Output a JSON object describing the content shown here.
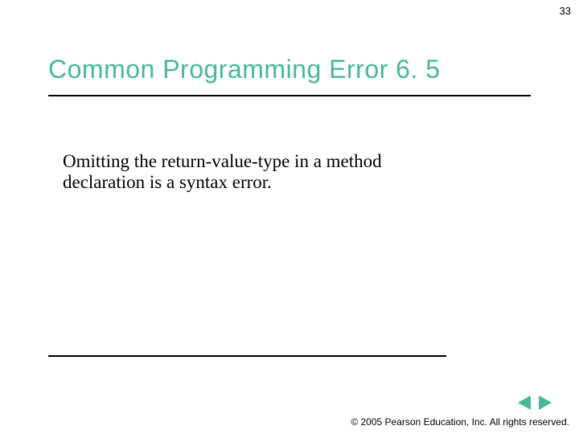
{
  "page_number": "33",
  "title": "Common Programming Error 6. 5",
  "body": "Omitting the return-value-type in a method declaration is a syntax error.",
  "copyright": "© 2005 Pearson Education, Inc.  All rights reserved.",
  "colors": {
    "accent": "#47b89b"
  }
}
